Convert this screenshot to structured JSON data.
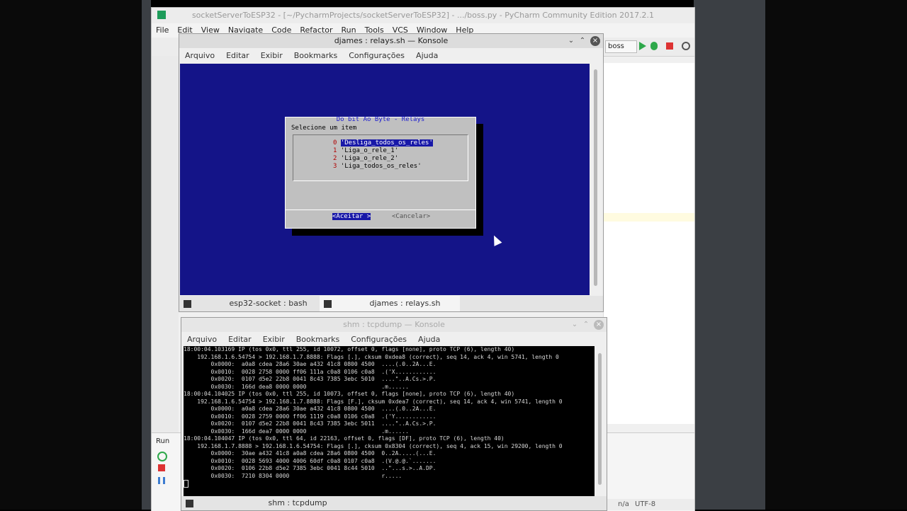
{
  "pycharm": {
    "title": "socketServerToESP32 - [~/PycharmProjects/socketServerToESP32] - .../boss.py - PyCharm Community Edition 2017.2.1",
    "menu": [
      "File",
      "Edit",
      "View",
      "Navigate",
      "Code",
      "Refactor",
      "Run",
      "Tools",
      "VCS",
      "Window",
      "Help"
    ],
    "run_config": "boss",
    "status_na": "n/a",
    "status_encoding": "UTF-8",
    "run_label": "Run"
  },
  "konsole1": {
    "title": "djames : relays.sh — Konsole",
    "menu": [
      "Arquivo",
      "Editar",
      "Exibir",
      "Bookmarks",
      "Configurações",
      "Ajuda"
    ],
    "tabs": [
      "esp32-socket : bash",
      "djames : relays.sh"
    ]
  },
  "dialog": {
    "title": "Do bit Ao Byte - Relays",
    "prompt": "Selecione um item",
    "items": [
      {
        "num": "0",
        "label": "'Desliga_todos_os_reles'",
        "selected": true
      },
      {
        "num": "1",
        "label": "'Liga_o_rele_1'"
      },
      {
        "num": "2",
        "label": "'Liga_o_rele_2'"
      },
      {
        "num": "3",
        "label": "'Liga_todos_os_reles'"
      }
    ],
    "ok_label": "<Aceitar >",
    "cancel_label": "<Cancelar>"
  },
  "konsole2": {
    "title": "shm : tcpdump — Konsole",
    "menu": [
      "Arquivo",
      "Editar",
      "Exibir",
      "Bookmarks",
      "Configurações",
      "Ajuda"
    ],
    "tab": "shm : tcpdump",
    "lines": [
      "18:00:04.103169 IP (tos 0x0, ttl 255, id 10072, offset 0, flags [none], proto TCP (6), length 40)",
      "    192.168.1.6.54754 > 192.168.1.7.8888: Flags [.], cksum 0xdea8 (correct), seq 14, ack 4, win 5741, length 0",
      "        0x0000:  a0a8 cdea 28a6 30ae a432 41c8 0800 4500  ....(.0..2A...E.",
      "        0x0010:  0028 2758 0000 ff06 111a c0a8 0106 c0a8  .('X............",
      "        0x0020:  0107 d5e2 22b8 0041 8c43 7385 3ebc 5010  ....\"..A.Cs.>.P.",
      "        0x0030:  166d dea8 0000 0000                      .m......",
      "18:00:04.104025 IP (tos 0x0, ttl 255, id 10073, offset 0, flags [none], proto TCP (6), length 40)",
      "    192.168.1.6.54754 > 192.168.1.7.8888: Flags [F.], cksum 0xdea7 (correct), seq 14, ack 4, win 5741, length 0",
      "        0x0000:  a0a8 cdea 28a6 30ae a432 41c8 0800 4500  ....(.0..2A...E.",
      "        0x0010:  0028 2759 0000 ff06 1119 c0a8 0106 c0a8  .('Y............",
      "        0x0020:  0107 d5e2 22b8 0041 8c43 7385 3ebc 5011  ....\"..A.Cs.>.P.",
      "        0x0030:  166d dea7 0000 0000                      .m......",
      "18:00:04.104047 IP (tos 0x0, ttl 64, id 22163, offset 0, flags [DF], proto TCP (6), length 40)",
      "    192.168.1.7.8888 > 192.168.1.6.54754: Flags [.], cksum 0x8304 (correct), seq 4, ack 15, win 29200, length 0",
      "        0x0000:  30ae a432 41c8 a0a8 cdea 28a6 0800 4500  0..2A.....(...E.",
      "        0x0010:  0028 5693 4000 4006 60df c0a8 0107 c0a8  .(V.@.@.`.......",
      "        0x0020:  0106 22b8 d5e2 7385 3ebc 0041 8c44 5010  ..\"...s.>..A.DP.",
      "        0x0030:  7210 8304 0000                           r.....",
      ""
    ]
  }
}
